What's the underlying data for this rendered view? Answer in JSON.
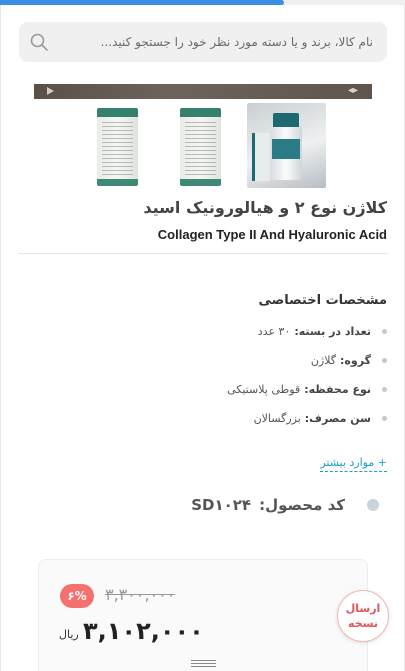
{
  "page": {
    "loading_progress": 0.7
  },
  "search": {
    "placeholder": "نام کالا، برند و یا دسته مورد نظر خود را جستجو کنید..."
  },
  "gallery": {
    "thumbnails": [
      "product-box-back",
      "product-box-side",
      "product-bottle-and-box"
    ]
  },
  "product": {
    "title_fa": "کلاژن نوع ۲ و هیالورونیک اسید",
    "title_en": "Collagen Type II And Hyaluronic Acid"
  },
  "specs": {
    "heading": "مشخصات اختصاصی",
    "items": [
      {
        "key": "تعداد در بسته:",
        "value": "۳۰ عدد"
      },
      {
        "key": "گروه:",
        "value": "گلاژن"
      },
      {
        "key": "نوع محفظه:",
        "value": "قوطی پلاستیکی"
      },
      {
        "key": "سن مصرف:",
        "value": "بزرگسالان"
      }
    ],
    "more_label": "+ موارد بیشتر"
  },
  "code": {
    "label": "کد محصول:",
    "value": "SD۱۰۲۴"
  },
  "price": {
    "discount": "۶%",
    "old": "۳,۳۰۰,۰۰۰",
    "current": "۳,۱۰۲,۰۰۰",
    "currency": "ریال"
  },
  "fab": {
    "label_line1": "ارسال",
    "label_line2": "نسخه"
  },
  "colors": {
    "accent": "#3a8ee6",
    "discount": "#f4716f",
    "link": "#19a0c3"
  }
}
